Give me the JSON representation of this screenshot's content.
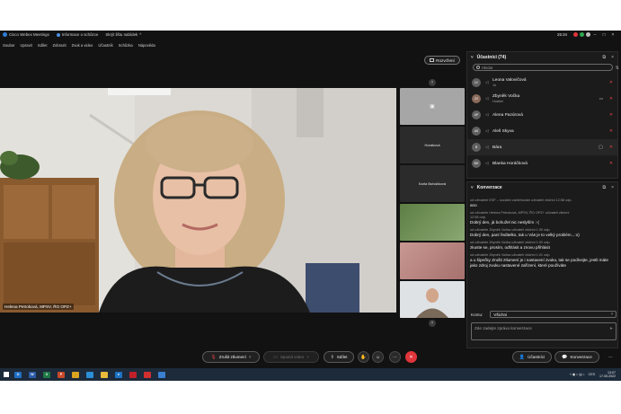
{
  "titlebar": {
    "app_name": "Cisco Webex Meetings",
    "meeting_info": "Informace o schůzce",
    "hide_menu": "Skrýt lištu nabídek",
    "time": "25:34"
  },
  "menubar": [
    "Soubor",
    "Upravit",
    "Sdílet",
    "Zobrazit",
    "Zvuk a video",
    "Účastník",
    "Schůzka",
    "Nápověda"
  ],
  "layout_button": "Rozvržení",
  "main_video": {
    "speaker_label": "Helena Petroková, MPSV, ŘO OPZ+"
  },
  "thumbnails": [
    {
      "label": "",
      "bg": "#a6a6a6"
    },
    {
      "label": "Horáková",
      "bg": "#2b2b2b"
    },
    {
      "label": "Karla Bohačková",
      "bg": "#2b2b2b"
    },
    {
      "label": "",
      "bg": "#6f8f5a"
    },
    {
      "label": "",
      "bg": "#b88a86"
    },
    {
      "label": "",
      "bg": "#d9dcdf"
    }
  ],
  "participants_panel": {
    "title": "Účastníci (74)",
    "search_placeholder": "Hledat",
    "participants": [
      {
        "initials": "LV",
        "name": "Leona Valovičová",
        "sub": "Já"
      },
      {
        "initials": "ZV",
        "name": "Zbyněk Vočka",
        "sub": "Hostitel"
      },
      {
        "initials": "AP",
        "name": "Alena Pazúrová",
        "sub": ""
      },
      {
        "initials": "AS",
        "name": "Aleš Skyva",
        "sub": ""
      },
      {
        "initials": "B",
        "name": "Bára",
        "sub": ""
      },
      {
        "initials": "BH",
        "name": "Blanka Horáčková",
        "sub": ""
      }
    ]
  },
  "chat_panel": {
    "title": "Konverzace",
    "messages": [
      {
        "meta": "od uživatele ESF – sociální začleňování uživateli všichni    12:58 odp.",
        "text": "ano"
      },
      {
        "meta": "od uživatele Helena Petroková, MPSV, ŘO OPZ+ uživateli všichni\n12:58 odp.",
        "text": "Dobrý den, já bohužel nic neslyším :-("
      },
      {
        "meta": "od uživatele Zbyněk Vočka uživateli všichni    1:00 odp.",
        "text": "Dobrý den, paní ředitelko, tak u Vás je to velký problém...:o)"
      },
      {
        "meta": "od uživatele Zbyněk Vočka uživateli všichni    1:00 odp.",
        "text": "zkuste se, prosím, odhlásit a znovu přihlásit"
      },
      {
        "meta": "od uživatele Zbyněk Vočka uživateli všichni    1:01 odp.",
        "text": "a u šipečky Zrušit ztlumení je i nastavení zvuku, tak se podívejte, jestli máte jako zdroj zvuku nastavené zařízení, které používáte"
      }
    ],
    "to_label": "Komu:",
    "to_value": "Všichni",
    "compose_placeholder": "Zde zadejte zprávu konverzace"
  },
  "toolbar": {
    "unmute": "Zrušit ztlumení",
    "start_video": "Spustit video",
    "share": "Sdílet",
    "participants": "Účastníci",
    "chat": "Konverzace"
  },
  "taskbar": {
    "apps": [
      {
        "label": "O",
        "color": "#1f6fc5"
      },
      {
        "label": "W",
        "color": "#2b5ca8"
      },
      {
        "label": "X",
        "color": "#1e7a45"
      },
      {
        "label": "P",
        "color": "#c94a2a"
      },
      {
        "label": "",
        "color": "#d9a520"
      },
      {
        "label": "",
        "color": "#2a8fd6"
      },
      {
        "label": "",
        "color": "#e8b93a"
      },
      {
        "label": "e",
        "color": "#1e73c4"
      },
      {
        "label": "",
        "color": "#c0202a"
      },
      {
        "label": "",
        "color": "#d03030"
      },
      {
        "label": "",
        "color": "#3a7fd0"
      }
    ],
    "lang": "CES",
    "clock_time": "13:07",
    "clock_date": "17.05.2022"
  },
  "colors": {
    "accent_red": "#e0353b",
    "app_bg": "#121212",
    "panel_bg": "#1b1b1b"
  }
}
